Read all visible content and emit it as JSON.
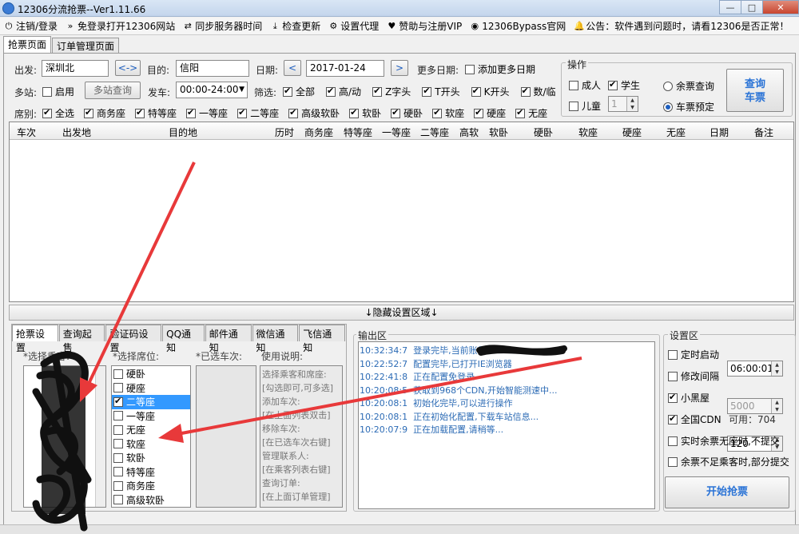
{
  "window": {
    "title": "12306分流抢票--Ver1.11.66",
    "min": "—",
    "max": "□",
    "close": "✕"
  },
  "toolbar": [
    {
      "icon": "power-icon",
      "glyph": "⏻",
      "label": "注销/登录"
    },
    {
      "icon": "double-chevron-icon",
      "glyph": "»",
      "label": "免登录打开12306网站"
    },
    {
      "icon": "sync-icon",
      "glyph": "⇄",
      "label": "同步服务器时间"
    },
    {
      "icon": "download-icon",
      "glyph": "⤓",
      "label": "检查更新"
    },
    {
      "icon": "gear-icon",
      "glyph": "⚙",
      "label": "设置代理"
    },
    {
      "icon": "heart-icon",
      "glyph": "♥",
      "label": "赞助与注册VIP"
    },
    {
      "icon": "globe-icon",
      "glyph": "◉",
      "label": "12306Bypass官网"
    },
    {
      "icon": "bell-icon",
      "glyph": "🔔",
      "label": "公告：软件遇到问题时，请看12306是否正常！"
    }
  ],
  "tabs": [
    "抢票页面",
    "订单管理页面"
  ],
  "search": {
    "from_label": "出发:",
    "from_value": "深圳北",
    "swap": "<->",
    "to_label": "目的:",
    "to_value": "信阳",
    "date_label": "日期:",
    "date_prev": "<",
    "date_value": "2017-01-24",
    "date_next": ">",
    "more_dates_label": "更多日期:",
    "add_more_dates": "添加更多日期",
    "multi_station_label": "多站:",
    "enable": "启用",
    "multi_query": "多站查询",
    "depart_label": "发车:",
    "depart_time": "00:00-24:00",
    "filter_label": "筛选:",
    "filters": [
      {
        "label": "全部",
        "on": true
      },
      {
        "label": "高/动",
        "on": true
      },
      {
        "label": "Z字头",
        "on": true
      },
      {
        "label": "T开头",
        "on": true
      },
      {
        "label": "K开头",
        "on": true
      },
      {
        "label": "数/临",
        "on": true
      }
    ],
    "seat_label": "席别:",
    "seats": [
      {
        "label": "全选",
        "on": true
      },
      {
        "label": "商务座",
        "on": true
      },
      {
        "label": "特等座",
        "on": true
      },
      {
        "label": "一等座",
        "on": true
      },
      {
        "label": "二等座",
        "on": true
      },
      {
        "label": "高级软卧",
        "on": true
      },
      {
        "label": "软卧",
        "on": true
      },
      {
        "label": "硬卧",
        "on": true
      },
      {
        "label": "软座",
        "on": true
      },
      {
        "label": "硬座",
        "on": true
      },
      {
        "label": "无座",
        "on": true
      }
    ]
  },
  "ops": {
    "title": "操作",
    "adult": "成人",
    "student": "学生",
    "child": "儿童",
    "child_count": "1",
    "remain_query": "余票查询",
    "book": "车票预定",
    "query_btn_line1": "查询",
    "query_btn_line2": "车票"
  },
  "grid_headers": [
    "车次",
    "出发地",
    "目的地",
    "历时",
    "商务座",
    "特等座",
    "一等座",
    "二等座",
    "高软",
    "软卧",
    "硬卧",
    "软座",
    "硬座",
    "无座",
    "日期",
    "备注"
  ],
  "hide_bar": "↓隐藏设置区域↓",
  "bottom_tabs": [
    "抢票设置",
    "查询起售",
    "验证码设置",
    "QQ通知",
    "邮件通知",
    "微信通知",
    "飞信通知"
  ],
  "grab": {
    "passenger_title": "*选择乘客:",
    "seat_title": "*选择席位:",
    "selected_train_title": "*已选车次:",
    "help_title": "使用说明:",
    "seat_options": [
      {
        "label": "硬卧",
        "on": false,
        "sel": false
      },
      {
        "label": "硬座",
        "on": false,
        "sel": false
      },
      {
        "label": "二等座",
        "on": true,
        "sel": true
      },
      {
        "label": "一等座",
        "on": false,
        "sel": false
      },
      {
        "label": "无座",
        "on": false,
        "sel": false
      },
      {
        "label": "软座",
        "on": false,
        "sel": false
      },
      {
        "label": "软卧",
        "on": false,
        "sel": false
      },
      {
        "label": "特等座",
        "on": false,
        "sel": false
      },
      {
        "label": "商务座",
        "on": false,
        "sel": false
      },
      {
        "label": "高级软卧",
        "on": false,
        "sel": false
      }
    ],
    "help_lines": [
      "选择乘客和席座:",
      "[勾选即可,可多选]",
      "添加车次:",
      "[在上面列表双击]",
      "移除车次:",
      "[在已选车次右键]",
      "管理联系人:",
      "[在乘客列表右键]",
      "查询订单:",
      "[在上面订单管理]"
    ]
  },
  "output": {
    "title": "输出区",
    "lines": [
      {
        "time": "10:32:34:7",
        "msg": "登录完毕,当前账号"
      },
      {
        "time": "10:22:52:7",
        "msg": "配置完毕,已打开IE浏览器"
      },
      {
        "time": "10:22:41:8",
        "msg": "正在配置免登录"
      },
      {
        "time": "10:20:08:5",
        "msg": "获取到968个CDN,开始智能测速中..."
      },
      {
        "time": "10:20:08:1",
        "msg": "初始化完毕,可以进行操作"
      },
      {
        "time": "10:20:08:1",
        "msg": "正在初始化配置,下载车站信息..."
      },
      {
        "time": "10:20:07:9",
        "msg": "正在加载配置,请稍等..."
      }
    ]
  },
  "settings": {
    "title": "设置区",
    "timed_start": "定时启动",
    "timed_value": "06:00:01",
    "modify_interval": "修改间隔",
    "interval_value": "5000",
    "black_room": "小黑屋",
    "black_value": "120",
    "global_cdn": "全国CDN",
    "cdn_available": "可用：704",
    "realtime_no_seat": "实时余票无座时,不提交",
    "partial_submit": "余票不足乘客时,部分提交",
    "start_btn": "开始抢票"
  },
  "colors": {
    "accent": "#3399ff",
    "log": "#2c6bb5",
    "arrow": "#e8393a"
  }
}
